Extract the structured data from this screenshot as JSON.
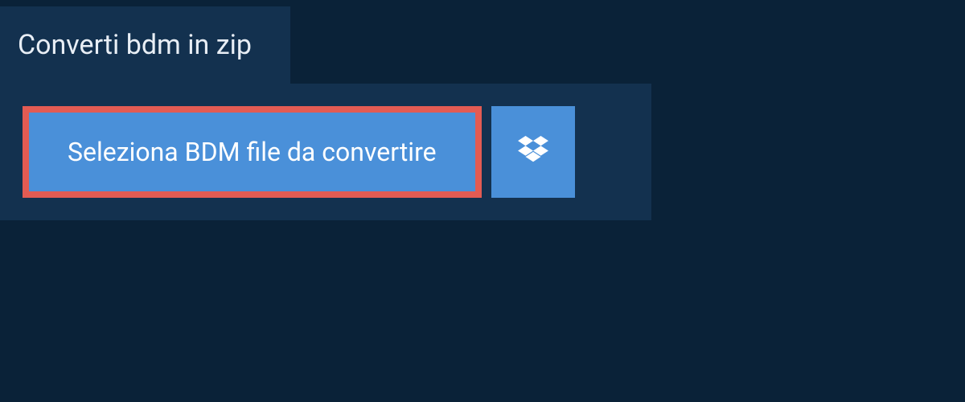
{
  "tab": {
    "title": "Converti bdm in zip"
  },
  "panel": {
    "select_button_label": "Seleziona BDM file da convertire"
  }
}
